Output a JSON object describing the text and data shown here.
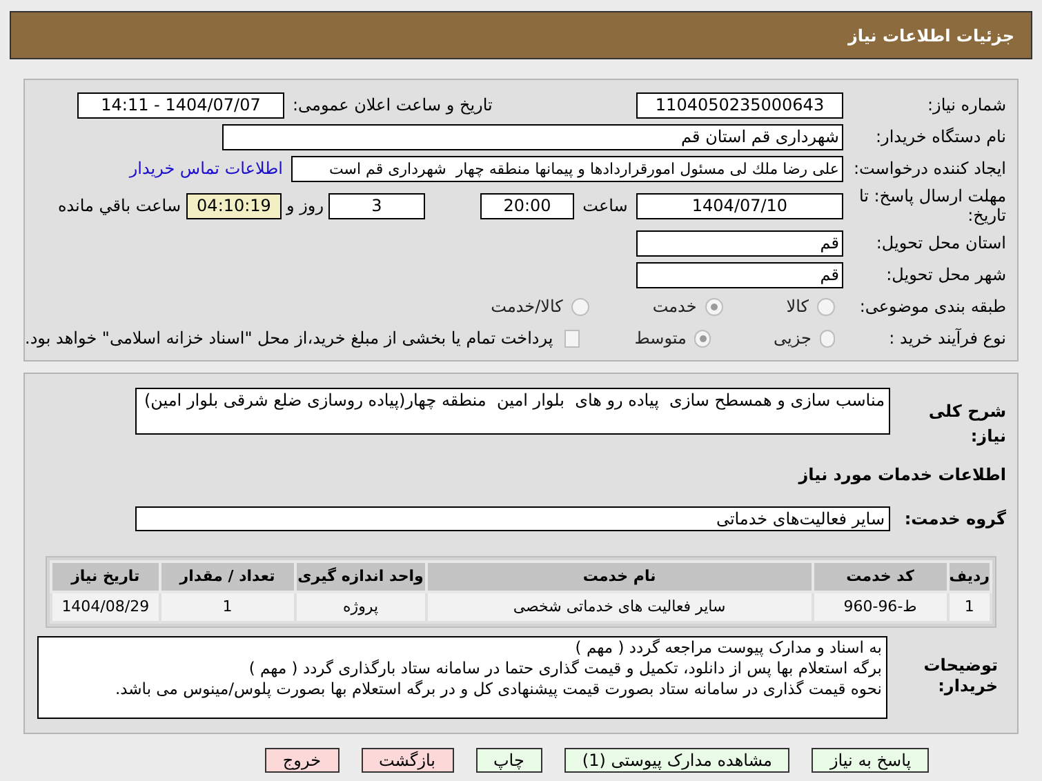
{
  "header": {
    "title": "جزئیات اطلاعات نیاز"
  },
  "need_info": {
    "need_number": {
      "label": "شماره نیاز:",
      "value": "1104050235000643"
    },
    "announce_date": {
      "label": "تاریخ و ساعت اعلان عمومی:",
      "value": "1404/07/07 - 14:11"
    },
    "buyer_org": {
      "label": "نام دستگاه خریدار:",
      "value": "شهرداری قم استان قم"
    },
    "requester": {
      "label": "ایجاد کننده درخواست:",
      "value": "علی رضا ملك لی مسئول امورقراردادها و پیمانها منطقه چهار  شهرداری قم است",
      "link": "اطلاعات تماس خریدار"
    },
    "deadline": {
      "label": "مهلت ارسال پاسخ: تا تاریخ:",
      "date": "1404/07/10",
      "time_label": "ساعت",
      "time": "20:00",
      "days": "3",
      "days_label": "روز و",
      "remaining": "04:10:19",
      "remaining_label": "ساعت باقي مانده"
    },
    "province": {
      "label": "استان محل تحویل:",
      "value": "قم"
    },
    "city": {
      "label": "شهر محل تحویل:",
      "value": "قم"
    },
    "category": {
      "label": "طبقه بندی موضوعی:",
      "options": [
        {
          "label": "کالا",
          "selected": false
        },
        {
          "label": "خدمت",
          "selected": true
        },
        {
          "label": "کالا/خدمت",
          "selected": false
        }
      ]
    },
    "purchase_type": {
      "label": "نوع فرآیند خرید :",
      "options": [
        {
          "label": "جزیی",
          "selected": false
        },
        {
          "label": "متوسط",
          "selected": true
        }
      ],
      "payment_note": {
        "label": "پرداخت تمام یا بخشی از مبلغ خرید،از محل \"اسناد خزانه اسلامی\" خواهد بود.",
        "checked": false
      }
    }
  },
  "details": {
    "description": {
      "label": "شرح کلی نیاز:",
      "value": "مناسب سازی و همسطح سازی  پیاده رو های  بلوار امین  منطقه چهار(پیاده روسازی ضلع شرقی بلوار امین)"
    },
    "services_title": "اطلاعات خدمات مورد نیاز",
    "service_group": {
      "label": "گروه خدمت:",
      "value": "سایر فعالیت‌های خدماتی"
    },
    "table": {
      "columns": [
        "ردیف",
        "کد خدمت",
        "نام خدمت",
        "واحد اندازه گیری",
        "تعداد / مقدار",
        "تاریخ نیاز"
      ],
      "rows": [
        [
          "1",
          "ط-96-960",
          "سایر فعالیت های خدماتی شخصی",
          "پروژه",
          "1",
          "1404/08/29"
        ]
      ]
    },
    "buyer_notes": {
      "label": "توضیحات خریدار:",
      "lines": [
        "به اسناد و مدارک پیوست مراجعه گردد ( مهم )",
        "برگه استعلام بها پس از دانلود، تکمیل و قیمت گذاری حتما در سامانه ستاد بارگذاری گردد ( مهم )",
        "نحوه قیمت گذاری در سامانه ستاد بصورت قیمت پیشنهادی کل و در برگه استعلام بها بصورت پلوس/مینوس می باشد."
      ]
    }
  },
  "buttons": [
    {
      "label": "پاسخ به نیاز",
      "kind": "primary"
    },
    {
      "label": "مشاهده مدارک پیوستی (1)",
      "kind": "primary"
    },
    {
      "label": "چاپ",
      "kind": "primary"
    },
    {
      "label": "بازگشت",
      "kind": "danger"
    },
    {
      "label": "خروج",
      "kind": "danger"
    }
  ]
}
